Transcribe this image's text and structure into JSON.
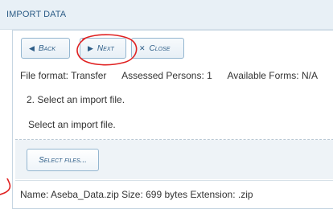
{
  "header": {
    "title": "IMPORT DATA"
  },
  "toolbar": {
    "back": {
      "label": "Back",
      "icon": "triangle-left-icon"
    },
    "next": {
      "label": "Next",
      "icon": "triangle-right-icon"
    },
    "close": {
      "label": "Close",
      "icon": "close-x-icon"
    }
  },
  "info": {
    "file_format": "File format: Transfer",
    "assessed_persons": "Assessed Persons: 1",
    "available_forms": "Available Forms: N/A"
  },
  "steps": {
    "step2": "2. Select an import file.",
    "instruction": "Select an import file."
  },
  "upload": {
    "select_files_label": "Select files..."
  },
  "file": {
    "name": "Name: Aseba_Data.zip",
    "size": "Size: 699 bytes",
    "extension": "Extension: .zip"
  },
  "colors": {
    "accent": "#2d5d87",
    "header_bg": "#e8f0f6",
    "annotation": "#e02020"
  }
}
